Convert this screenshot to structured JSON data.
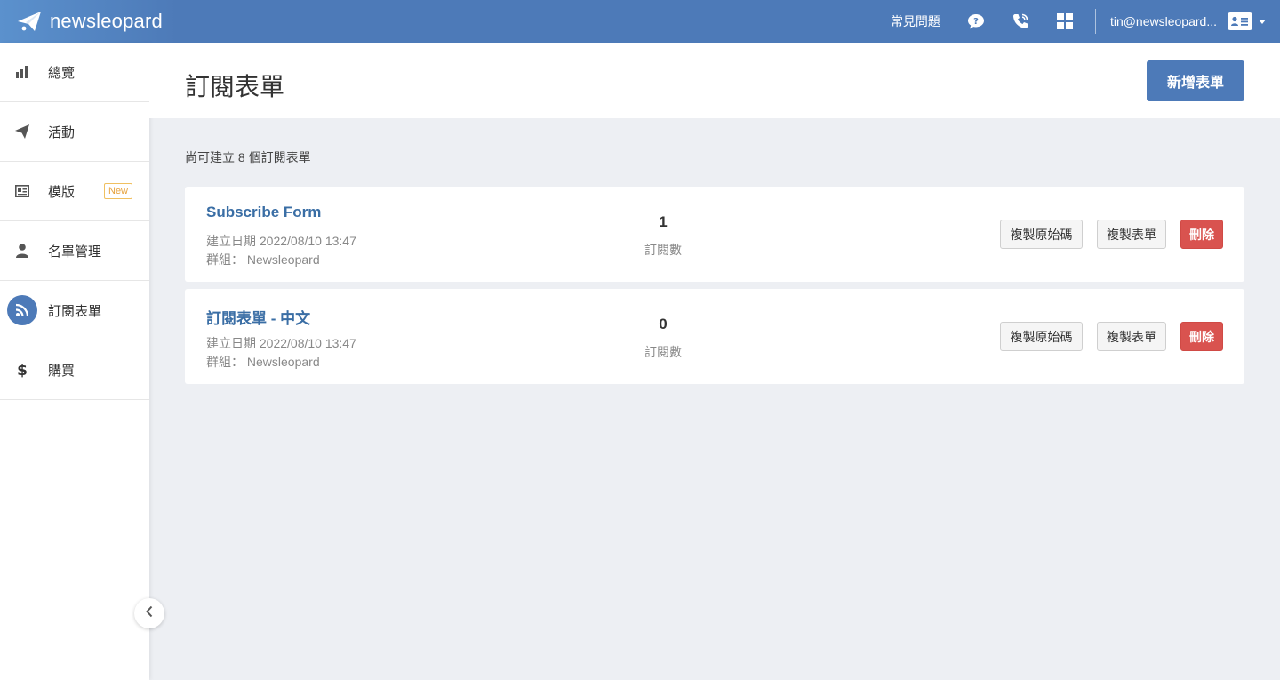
{
  "brand": {
    "name": "newsleopard"
  },
  "topbar": {
    "faq_label": "常見問題",
    "user_email": "tin@newsleopard..."
  },
  "sidebar": {
    "items": [
      {
        "label": "總覽",
        "icon": "bar-chart-icon"
      },
      {
        "label": "活動",
        "icon": "paper-plane-icon"
      },
      {
        "label": "模版",
        "icon": "template-icon",
        "badge": "New"
      },
      {
        "label": "名單管理",
        "icon": "user-icon"
      },
      {
        "label": "訂閱表單",
        "icon": "rss-icon",
        "active": true
      },
      {
        "label": "購買",
        "icon": "dollar-icon"
      }
    ]
  },
  "page": {
    "title": "訂閱表單",
    "add_button": "新增表單",
    "remaining_text": "尚可建立 8 個訂閱表單"
  },
  "forms": [
    {
      "name": "Subscribe Form",
      "created": "建立日期 2022/08/10 13:47",
      "group": "群組： Newsleopard",
      "count": "1",
      "count_label": "訂閱數",
      "copy_code_label": "複製原始碼",
      "copy_form_label": "複製表單",
      "delete_label": "刪除"
    },
    {
      "name": "訂閱表單 - 中文",
      "created": "建立日期 2022/08/10 13:47",
      "group": "群組： Newsleopard",
      "count": "0",
      "count_label": "訂閱數",
      "copy_code_label": "複製原始碼",
      "copy_form_label": "複製表單",
      "delete_label": "刪除"
    }
  ],
  "colors": {
    "primary": "#4d7ab8",
    "link": "#3a6ea5",
    "danger": "#d9534f",
    "badge": "#e6a23c",
    "background": "#edeff3"
  }
}
